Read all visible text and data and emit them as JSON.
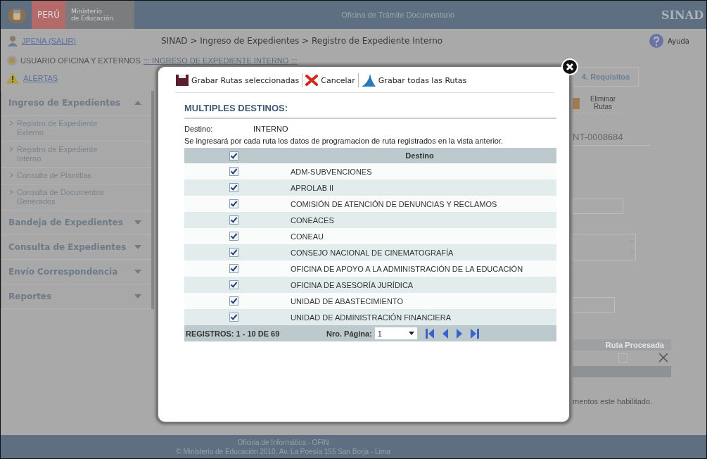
{
  "header": {
    "country": "PERÚ",
    "ministry": [
      "Ministerio",
      "de Educación"
    ],
    "title": "Oficina de Trámite Documentario",
    "brand": "SINAD"
  },
  "user": {
    "link": "JPENA (SALIR)",
    "role": "USUARIO OFICINA Y EXTERNOS",
    "section": "::: INGRESO DE EXPEDIENTE INTERNO :::",
    "alerts": "ALERTAS"
  },
  "breadcrumb": "SINAD > Ingreso de Expedientes > Registro de Expediente Interno",
  "help": "Ayuda",
  "sidebar": {
    "groups": [
      {
        "label": "Ingreso de Expedientes",
        "expanded": true,
        "children": [
          {
            "label": "Registro de Expediente Externo"
          },
          {
            "label": "Registro de Expediente Interno"
          },
          {
            "label": "Consulta de Plantillas"
          },
          {
            "label": "Consulta de Documentos Generados"
          }
        ]
      },
      {
        "label": "Bandeja de Expedientes",
        "expanded": false
      },
      {
        "label": "Consulta de Expedientes",
        "expanded": false
      },
      {
        "label": "Envío Correspondencia",
        "expanded": false
      },
      {
        "label": "Reportes",
        "expanded": false
      }
    ]
  },
  "background": {
    "tab": "4. Requisitos",
    "delete_routes": "Eliminar Rutas",
    "record_number": "NT-0008684",
    "routes_table": {
      "column": "Ruta Procesada",
      "row_checked": false
    },
    "note": "mentos este habilitado."
  },
  "modal": {
    "toolbar": [
      {
        "kind": "save",
        "label": "Grabar Rutas seleccionadas"
      },
      {
        "kind": "cancel",
        "label": "Cancelar"
      },
      {
        "kind": "save_all",
        "label": "Grabar todas las Rutas"
      }
    ],
    "title": "MULTIPLES DESTINOS:",
    "destination_label": "Destino:",
    "destination_value": "INTERNO",
    "note": "Se ingresará por cada ruta los datos de programacion de ruta registrados en la vista anterior.",
    "table": {
      "header_checked": true,
      "column": "Destino",
      "rows": [
        {
          "name": "ADM-SUBVENCIONES",
          "checked": true
        },
        {
          "name": "APROLAB II",
          "checked": true
        },
        {
          "name": "COMISIÓN DE ATENCIÓN DE DENUNCIAS Y RECLAMOS",
          "checked": true
        },
        {
          "name": "CONEACES",
          "checked": true
        },
        {
          "name": "CONEAU",
          "checked": true
        },
        {
          "name": "CONSEJO NACIONAL DE CINEMATOGRAFÍA",
          "checked": true
        },
        {
          "name": "OFICINA DE APOYO A LA ADMINISTRACIÓN DE LA EDUCACIÓN",
          "checked": true
        },
        {
          "name": "OFICINA DE ASESORÍA JURÍDICA",
          "checked": true
        },
        {
          "name": "UNIDAD DE ABASTECIMIENTO",
          "checked": true
        },
        {
          "name": "UNIDAD DE ADMINISTRACIÓN FINANCIERA",
          "checked": true
        }
      ]
    },
    "pager": {
      "records": "REGISTROS: 1 - 10 DE 69",
      "page_label": "Nro. Página:",
      "page": "1"
    }
  },
  "footer": [
    "Oficina de Informática - OFIN",
    "© Ministerio de Educación 2010, Av. La Poesía 155 San Borja - Lima"
  ]
}
